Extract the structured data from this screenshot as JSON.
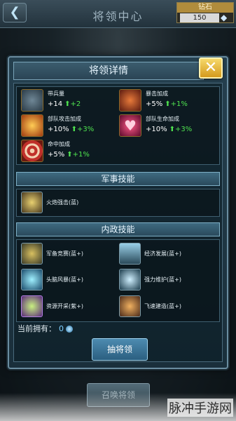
{
  "topbar": {
    "back_icon": "back-arrow-icon",
    "title": "将领中心",
    "diamond_label": "钻石",
    "diamond_count": "150"
  },
  "modal": {
    "title": "将领详情",
    "close_label": "✕"
  },
  "stats": [
    {
      "icon": "tank-icon",
      "label": "带兵量",
      "value": "+14",
      "bonus": "+2",
      "color": "#3a4a55"
    },
    {
      "icon": "missile-icon",
      "label": "暴击加成",
      "value": "+5%",
      "bonus": "+1%",
      "color": "#5a2a22"
    },
    {
      "icon": "explosion-icon",
      "label": "部队攻击加成",
      "value": "+10%",
      "bonus": "+3%",
      "color": "#8a3a12"
    },
    {
      "icon": "heart-icon",
      "label": "部队生命加成",
      "value": "+10%",
      "bonus": "+3%",
      "color": "#6a1a3a"
    },
    {
      "icon": "target-icon",
      "label": "命中加成",
      "value": "+5%",
      "bonus": "+1%",
      "color": "#8a2a1a"
    }
  ],
  "sections": {
    "military": "军事技能",
    "domestic": "内政技能"
  },
  "military_skills": [
    {
      "icon": "artillery-icon",
      "label": "火炮强击(蓝)"
    }
  ],
  "domestic_skills": [
    {
      "icon": "arms-race-icon",
      "label": "军备竞赛(蓝+)"
    },
    {
      "icon": "economy-icon",
      "label": "经济发展(蓝+)"
    },
    {
      "icon": "storm-icon",
      "label": "头脑风暴(蓝+)"
    },
    {
      "icon": "repair-icon",
      "label": "强力维护(蓝+)"
    },
    {
      "icon": "resource-icon",
      "label": "资源开采(紫+)"
    },
    {
      "icon": "build-icon",
      "label": "飞速建造(蓝+)"
    }
  ],
  "owned": {
    "label": "当前拥有：",
    "count": "0"
  },
  "draw_button": "抽将领",
  "summon_button": "召唤将领",
  "watermark": "脉冲手游网"
}
